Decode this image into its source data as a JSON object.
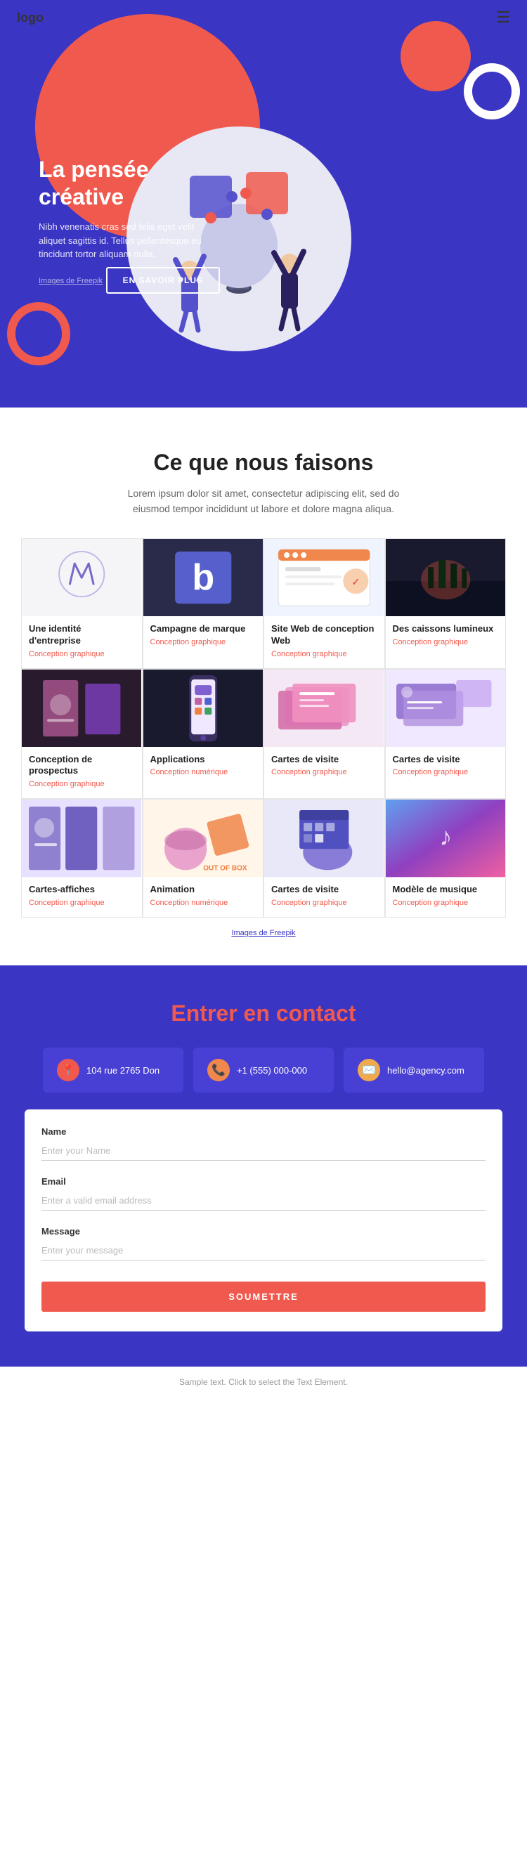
{
  "navbar": {
    "logo": "logo",
    "menu_icon": "☰"
  },
  "hero": {
    "title": "La pensée créative",
    "description": "Nibh venenatis cras sed felis eget velit aliquet sagittis id. Tellus pellentesque eu tincidunt tortor aliquam nulla.",
    "image_credit": "Images de Freepik",
    "button_label": "EN SAVOIR PLUS"
  },
  "services": {
    "title": "Ce que nous faisons",
    "description": "Lorem ipsum dolor sit amet, consectetur adipiscing elit, sed do eiusmod tempor incididunt ut labore et dolore magna aliqua.",
    "grid_credit": "Images de Freepik",
    "items": [
      {
        "name": "Une identité d'entreprise",
        "category": "Conception graphique",
        "bg": "#f5f5f8",
        "accent": "#7b68c8"
      },
      {
        "name": "Campagne de marque",
        "category": "Conception graphique",
        "bg": "#2a2a4a",
        "accent": "#5560cc"
      },
      {
        "name": "Site Web de conception Web",
        "category": "Conception graphique",
        "bg": "#f0f4ff",
        "accent": "#f0884e"
      },
      {
        "name": "Des caissons lumineux",
        "category": "Conception graphique",
        "bg": "#1a1a2e",
        "accent": "#888"
      },
      {
        "name": "Conception de prospectus",
        "category": "Conception graphique",
        "bg": "#2a1a2e",
        "accent": "#c060a0"
      },
      {
        "name": "Applications",
        "category": "Conception numérique",
        "bg": "#1a1a2e",
        "accent": "#7050c0"
      },
      {
        "name": "Cartes de visite",
        "category": "Conception graphique",
        "bg": "#f5e8f5",
        "accent": "#c050a0"
      },
      {
        "name": "Cartes de visite",
        "category": "Conception graphique",
        "bg": "#f0e8ff",
        "accent": "#9070d0"
      },
      {
        "name": "Cartes-affiches",
        "category": "Conception graphique",
        "bg": "#e8e0ff",
        "accent": "#7060c0"
      },
      {
        "name": "Animation",
        "category": "Conception numérique",
        "bg": "#fff0e0",
        "accent": "#f0884e"
      },
      {
        "name": "Cartes de visite",
        "category": "Conception graphique",
        "bg": "#e8e8ff",
        "accent": "#5060c0"
      },
      {
        "name": "Modèle de musique",
        "category": "Conception graphique",
        "bg": "#e0e8ff",
        "accent": "#9040c0"
      }
    ]
  },
  "contact": {
    "title": "Entrer en contact",
    "address": "104 rue 2765 Don",
    "phone": "+1 (555) 000-000",
    "email": "hello@agency.com",
    "form": {
      "name_label": "Name",
      "name_placeholder": "Enter your Name",
      "email_label": "Email",
      "email_placeholder": "Enter a valid email address",
      "message_label": "Message",
      "message_placeholder": "Enter your message",
      "submit_label": "SOUMETTRE"
    }
  },
  "footer": {
    "note": "Sample text. Click to select the Text Element."
  }
}
